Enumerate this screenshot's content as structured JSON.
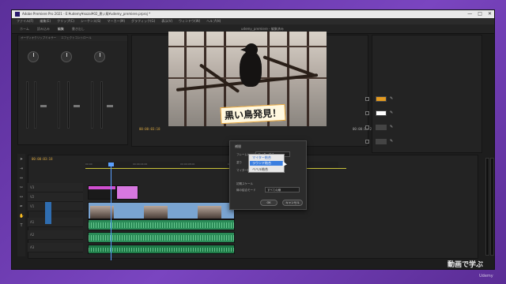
{
  "window": {
    "title": "Adobe Premiere Pro 2021 - E:¥udemy¥sozai¥02_黒い鳥¥udemy_premiere.prproj *",
    "controls": [
      "—",
      "□",
      "✕"
    ]
  },
  "menu": [
    "ファイル(F)",
    "編集(E)",
    "クリップ(C)",
    "シーケンス(S)",
    "マーカー(M)",
    "グラフィック(G)",
    "表示(V)",
    "ウィンドウ(W)",
    "ヘルプ(H)"
  ],
  "workspace": {
    "tabs": [
      "ホーム",
      "読み込み",
      "編集",
      "書き出し"
    ],
    "active": "編集",
    "project_title": "udemy_premiere - 編集済み"
  },
  "source": {
    "tabs": [
      "オーディオクリップミキサー",
      "エフェクトコントロール",
      "ソース"
    ]
  },
  "program": {
    "caption": "黒い鳥発見！",
    "timecode_left": "00:00:03:18",
    "timecode_right": "00:00:14:23"
  },
  "essential": {
    "swatch_colors": [
      "#e39a20",
      "#ffffff",
      "#444444",
      "#444444"
    ]
  },
  "timeline": {
    "timecode": "00:00:03:18",
    "ruler_ticks": [
      "00:00",
      "00:00:04:00",
      "00:00:08:00",
      "00:00:12:00",
      "00:00:16:00",
      "00:00:20:00",
      "00:00:24:00",
      "00:00:28:00"
    ],
    "tracks": [
      "V3",
      "V2",
      "V1",
      "A1",
      "A2",
      "A3"
    ]
  },
  "dialog": {
    "title": "補間",
    "label_type": "フレームレート",
    "select_value": "マイター結合",
    "label_fill": "塗り",
    "label_ratio": "マイター制",
    "section": "初期スケール",
    "label_mode": "線の結合モード",
    "mode_value": "すべての線",
    "ok": "OK",
    "cancel": "キャンセル"
  },
  "dropdown": {
    "options": [
      "マイター結合",
      "ラウンド結合",
      "ベベル結合"
    ],
    "selected": "マイター結合",
    "highlighted": "ラウンド結合"
  },
  "watermark": "動画で学ぶ",
  "brand": "Udemy"
}
